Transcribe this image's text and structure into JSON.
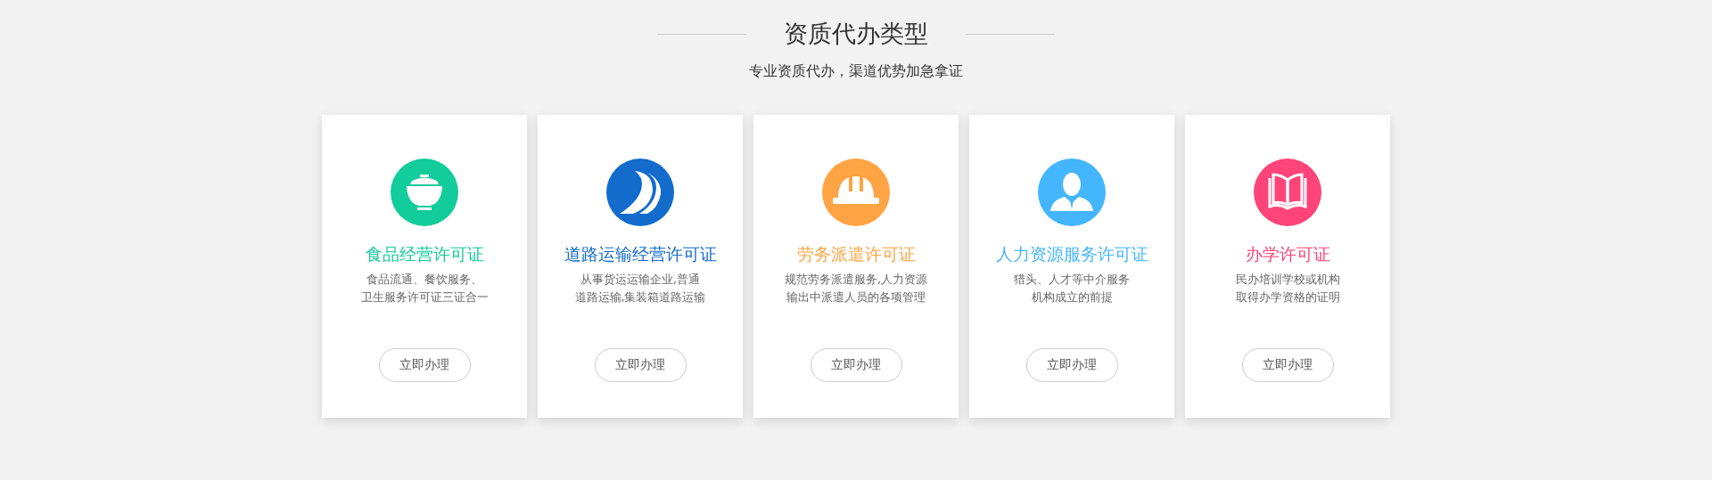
{
  "header": {
    "title": "资质代办类型",
    "subtitle": "专业资质代办，渠道优势加急拿证"
  },
  "cards": [
    {
      "title": "食品经营许可证",
      "color": "#13cc9b",
      "description": [
        "食品流通、餐饮服务、",
        "卫生服务许可证三证合一"
      ],
      "button": "立即办理"
    },
    {
      "title": "道路运输经营许可证",
      "color": "#136ccc",
      "description": [
        "从事货运运输企业,普通",
        "道路运输,集装箱道路运输"
      ],
      "button": "立即办理"
    },
    {
      "title": "劳务派遣许可证",
      "color": "#fea444",
      "description": [
        "规范劳务派遣服务,人力资源",
        "输出中派遣人员的各项管理"
      ],
      "button": "立即办理"
    },
    {
      "title": "人力资源服务许可证",
      "color": "#44b6fe",
      "description": [
        "猎头、人才等中介服务",
        "机构成立的前提"
      ],
      "button": "立即办理"
    },
    {
      "title": "办学许可证",
      "color": "#fe4478",
      "description": [
        "民办培训学校或机构",
        "取得办学资格的证明"
      ],
      "button": "立即办理"
    }
  ]
}
